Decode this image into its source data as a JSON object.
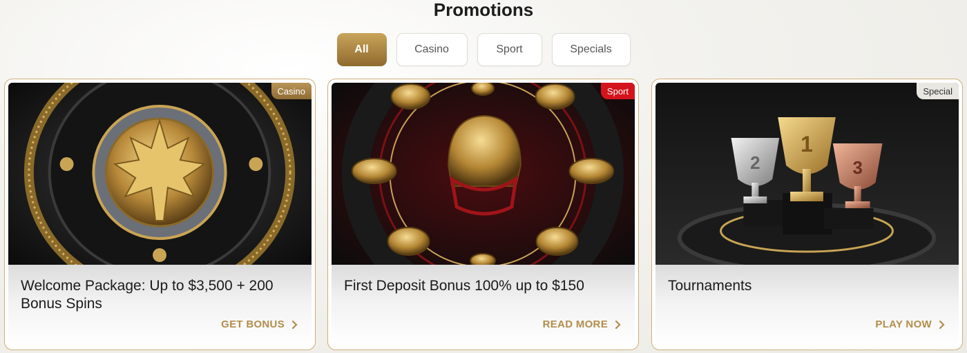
{
  "page": {
    "title": "Promotions"
  },
  "filters": [
    {
      "label": "All",
      "active": true
    },
    {
      "label": "Casino",
      "active": false
    },
    {
      "label": "Sport",
      "active": false
    },
    {
      "label": "Specials",
      "active": false
    }
  ],
  "cards": [
    {
      "badge": "Casino",
      "title": "Welcome Package: Up to $3,500 + 200 Bonus Spins",
      "cta": "GET BONUS",
      "image": "gold-maple-leaf-coin-image"
    },
    {
      "badge": "Sport",
      "title": "First Deposit Bonus 100% up to $150",
      "cta": "READ MORE",
      "image": "gold-football-helmet-image"
    },
    {
      "badge": "Special",
      "title": "Tournaments",
      "cta": "PLAY NOW",
      "image": "trophy-cups-image"
    }
  ],
  "colors": {
    "accent": "#b28d4b",
    "sport_badge": "#d4141c",
    "card_border": "#cfae78"
  }
}
